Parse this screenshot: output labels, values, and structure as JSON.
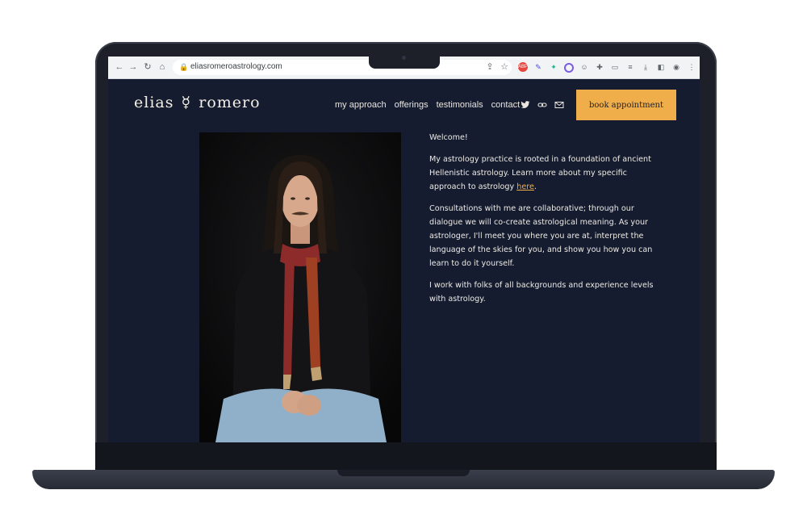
{
  "browser": {
    "url": "eliasromeroastrology.com",
    "nav_icons": [
      "back-icon",
      "forward-icon",
      "reload-icon",
      "home-icon"
    ],
    "extension_icons": [
      "share-icon",
      "star-icon",
      "adblock-icon",
      "pen-icon",
      "leaf-icon",
      "color-icon",
      "face-icon",
      "puzzle-icon",
      "cast-icon",
      "playlist-icon",
      "download-icon",
      "sidebar-icon",
      "eye-icon",
      "menu-icon"
    ]
  },
  "site": {
    "logo_left": "elias",
    "logo_right": "romero",
    "nav": [
      "my approach",
      "offerings",
      "testimonials",
      "contact"
    ],
    "social_icons": [
      "twitter-icon",
      "link-icon",
      "mail-icon"
    ],
    "book_button": "book appointment",
    "accent_color": "#f0ae4a",
    "background_color": "#161c30"
  },
  "content": {
    "welcome": "Welcome!",
    "p1_before": "My astrology practice is rooted in a foundation of ancient Hellenistic astrology.  Learn more about my specific approach to astrology ",
    "p1_link": "here",
    "p1_after": ".",
    "p2": "Consultations with me are collaborative; through our dialogue we will co-create astrological meaning. As your astrologer, I'll meet you where you are at, interpret the language of the skies for you, and show you how you can learn to do it yourself.",
    "p3": "I work with folks of all backgrounds and experience levels with astrology."
  }
}
